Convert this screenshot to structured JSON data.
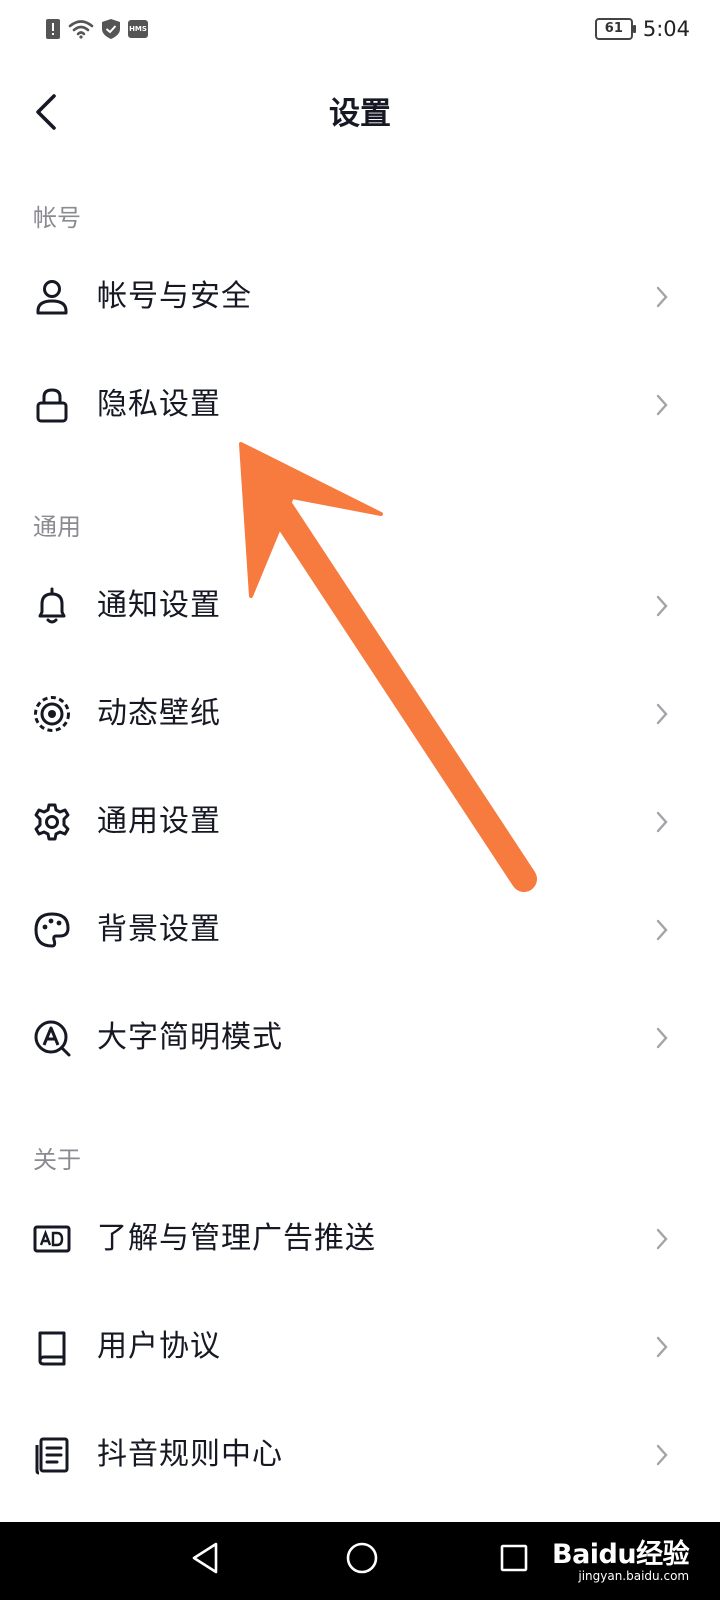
{
  "status_bar": {
    "time": "5:04",
    "battery_level": "61",
    "hms_badge": "HMS",
    "icons": [
      "alert-icon",
      "wifi-icon",
      "shield-check-icon",
      "hms-icon"
    ]
  },
  "header": {
    "title": "设置",
    "back_icon": "chevron-left-icon"
  },
  "sections": {
    "account": {
      "label": "帐号",
      "items": [
        {
          "label": "帐号与安全",
          "icon": "user-icon"
        },
        {
          "label": "隐私设置",
          "icon": "lock-icon"
        }
      ]
    },
    "general": {
      "label": "通用",
      "items": [
        {
          "label": "通知设置",
          "icon": "bell-icon"
        },
        {
          "label": "动态壁纸",
          "icon": "target-icon"
        },
        {
          "label": "通用设置",
          "icon": "gear-icon"
        },
        {
          "label": "背景设置",
          "icon": "palette-icon"
        },
        {
          "label": "大字简明模式",
          "icon": "font-a-icon"
        }
      ]
    },
    "about": {
      "label": "关于",
      "items": [
        {
          "label": "了解与管理广告推送",
          "icon": "ad-icon"
        },
        {
          "label": "用户协议",
          "icon": "book-icon"
        },
        {
          "label": "抖音规则中心",
          "icon": "document-icon"
        }
      ]
    }
  },
  "annotation": {
    "arrow_color": "#f77a3f",
    "points_to": "隐私设置"
  },
  "nav_bar": {
    "icons": [
      "nav-back-icon",
      "nav-home-icon",
      "nav-recent-icon"
    ]
  },
  "watermark": {
    "brand": "Baidu经验",
    "sub": "jingyan.baidu.com"
  }
}
